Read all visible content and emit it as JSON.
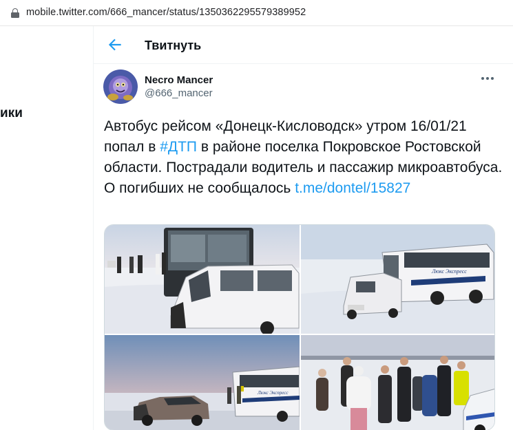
{
  "browser": {
    "url": "mobile.twitter.com/666_mancer/status/1350362295579389952"
  },
  "left_nav": {
    "partial_label": "ики"
  },
  "header": {
    "title": "Твитнуть"
  },
  "tweet": {
    "author_name": "Necro Mancer",
    "author_handle": "@666_mancer",
    "text_part1": "Автобус рейсом «Донецк-Кисловодск» утром 16/01/21 попал в ",
    "hashtag": "#ДТП",
    "text_part2": " в районе поселка Покровское Ростовской области. Пострадали водитель и пассажир микроавтобуса. О погибших не сообщалось ",
    "link": "t.me/dontel/15827",
    "bus_lettering": "Люкс Экспресс"
  },
  "colors": {
    "link": "#1d9bf0",
    "text": "#0f1419",
    "secondary": "#536471"
  }
}
